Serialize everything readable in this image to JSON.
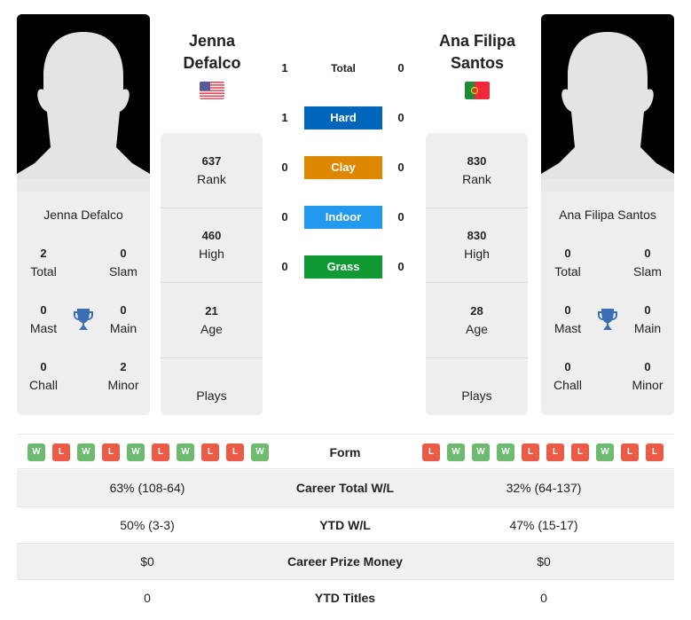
{
  "player_left": {
    "name": "Jenna Defalco",
    "name_line1": "Jenna",
    "name_line2": "Defalco",
    "country_flag": "usa-flag",
    "rank": "637",
    "rank_label": "Rank",
    "high": "460",
    "high_label": "High",
    "age": "21",
    "age_label": "Age",
    "plays": "",
    "plays_label": "Plays",
    "titles": {
      "total": "2",
      "total_label": "Total",
      "slam": "0",
      "slam_label": "Slam",
      "mast": "0",
      "mast_label": "Mast",
      "main": "0",
      "main_label": "Main",
      "chall": "0",
      "chall_label": "Chall",
      "minor": "2",
      "minor_label": "Minor"
    },
    "form": [
      "W",
      "L",
      "W",
      "L",
      "W",
      "L",
      "W",
      "L",
      "L",
      "W"
    ]
  },
  "player_right": {
    "name": "Ana Filipa Santos",
    "name_line1": "Ana Filipa",
    "name_line2": "Santos",
    "country_flag": "portugal-flag",
    "rank": "830",
    "rank_label": "Rank",
    "high": "830",
    "high_label": "High",
    "age": "28",
    "age_label": "Age",
    "plays": "",
    "plays_label": "Plays",
    "titles": {
      "total": "0",
      "total_label": "Total",
      "slam": "0",
      "slam_label": "Slam",
      "mast": "0",
      "mast_label": "Mast",
      "main": "0",
      "main_label": "Main",
      "chall": "0",
      "chall_label": "Chall",
      "minor": "0",
      "minor_label": "Minor"
    },
    "form": [
      "L",
      "W",
      "W",
      "W",
      "L",
      "L",
      "L",
      "W",
      "L",
      "L"
    ]
  },
  "h2h": [
    {
      "label": "Total",
      "left": "1",
      "right": "0",
      "color": ""
    },
    {
      "label": "Hard",
      "left": "1",
      "right": "0",
      "color": "#0066bb"
    },
    {
      "label": "Clay",
      "left": "0",
      "right": "0",
      "color": "#dd8800"
    },
    {
      "label": "Indoor",
      "left": "0",
      "right": "0",
      "color": "#2299ee"
    },
    {
      "label": "Grass",
      "left": "0",
      "right": "0",
      "color": "#119933"
    }
  ],
  "form_label": "Form",
  "stats": [
    {
      "label": "Career Total W/L",
      "left": "63% (108-64)",
      "right": "32% (64-137)"
    },
    {
      "label": "YTD W/L",
      "left": "50% (3-3)",
      "right": "47% (15-17)"
    },
    {
      "label": "Career Prize Money",
      "left": "$0",
      "right": "$0"
    },
    {
      "label": "YTD Titles",
      "left": "0",
      "right": "0"
    }
  ]
}
